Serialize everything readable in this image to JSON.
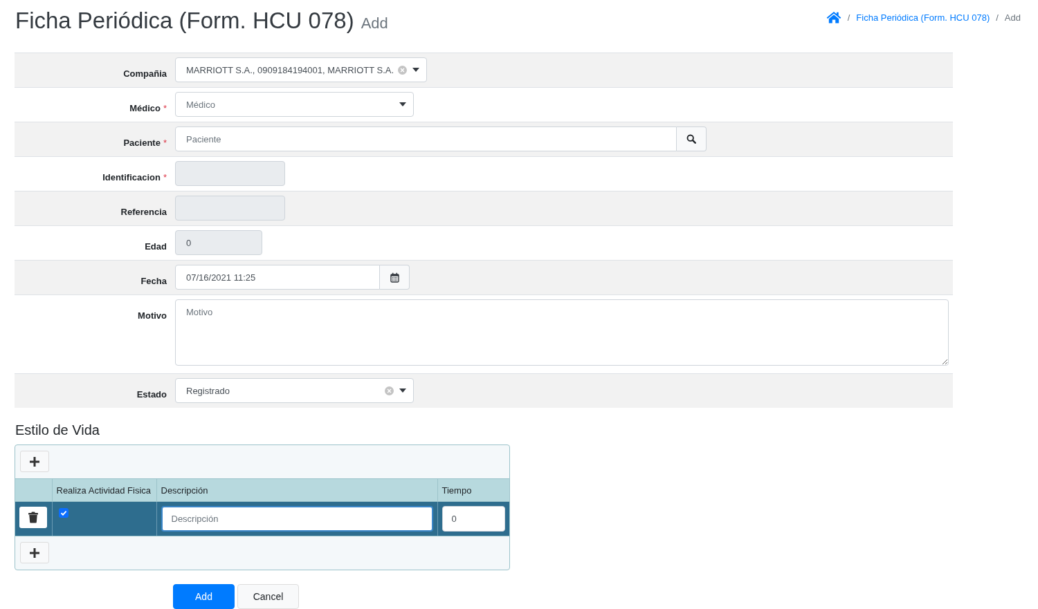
{
  "page_header": {
    "title": "Ficha Periódica (Form. HCU 078)",
    "subtitle": "Add"
  },
  "breadcrumb": [
    {
      "kind": "home"
    },
    {
      "kind": "link",
      "separator": "/",
      "label": "Ficha Periódica (Form. HCU 078)"
    },
    {
      "kind": "current",
      "separator": "/",
      "label": "Add"
    }
  ],
  "form": {
    "fields": [
      {
        "label": "Compañia",
        "kind": "select",
        "value": "MARRIOTT S.A., 0909184194001, MARRIOTT S.A.",
        "clearable": true
      },
      {
        "label": "Médico",
        "required_mark": "*",
        "kind": "select",
        "placeholder": "Médico",
        "clearable": false
      },
      {
        "label": "Paciente",
        "required_mark": "*",
        "kind": "search",
        "placeholder": "Paciente"
      },
      {
        "label": "Identificacion",
        "required_mark": "*",
        "kind": "text",
        "disabled": true
      },
      {
        "label": "Referencia",
        "kind": "text",
        "disabled": true
      },
      {
        "label": "Edad",
        "kind": "text",
        "disabled": true,
        "value": "0"
      },
      {
        "label": "Fecha",
        "kind": "date",
        "value": "07/16/2021 11:25"
      },
      {
        "label": "Motivo",
        "kind": "textarea",
        "placeholder": "Motivo"
      },
      {
        "label": "Estado",
        "kind": "select",
        "value": "Registrado",
        "clearable": true
      }
    ]
  },
  "lifestyle": {
    "title": "Estilo de Vida",
    "columns": [
      "Realiza Actividad Fisica",
      "Descripción",
      "Tiempo"
    ],
    "rows": [
      {
        "selected": true,
        "checked": true,
        "description": {
          "placeholder": "Descripción",
          "focused": true
        },
        "time": {
          "value": "0"
        }
      }
    ]
  },
  "buttons": [
    {
      "label": "Add",
      "kind": "submit"
    },
    {
      "label": "Cancel",
      "kind": "cancel"
    }
  ]
}
